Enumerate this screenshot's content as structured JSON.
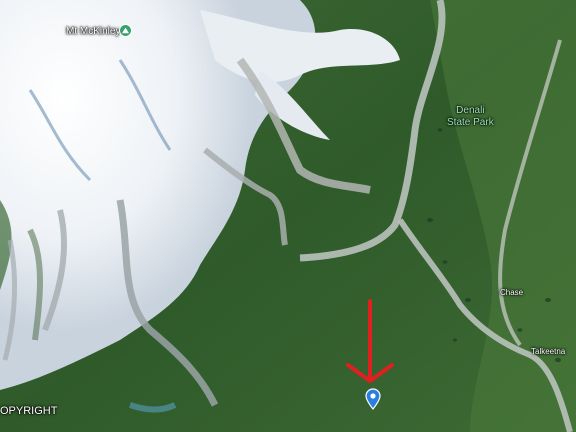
{
  "map": {
    "type": "satellite",
    "region": "Denali, Alaska"
  },
  "labels": {
    "peak": "Mt McKinley",
    "park_line1": "Denali",
    "park_line2": "State Park",
    "chase": "Chase",
    "talkeetna": "Talkeetna",
    "copyright": "OPYRIGHT"
  },
  "markers": {
    "peak_icon": "mountain-peak-icon",
    "pin_icon": "location-pin-icon",
    "arrow_icon": "down-arrow-icon"
  },
  "colors": {
    "arrow": "#e02020",
    "pin": "#2b7fe0",
    "peak_badge": "#36a36a",
    "park_label": "#9fe2b6"
  }
}
